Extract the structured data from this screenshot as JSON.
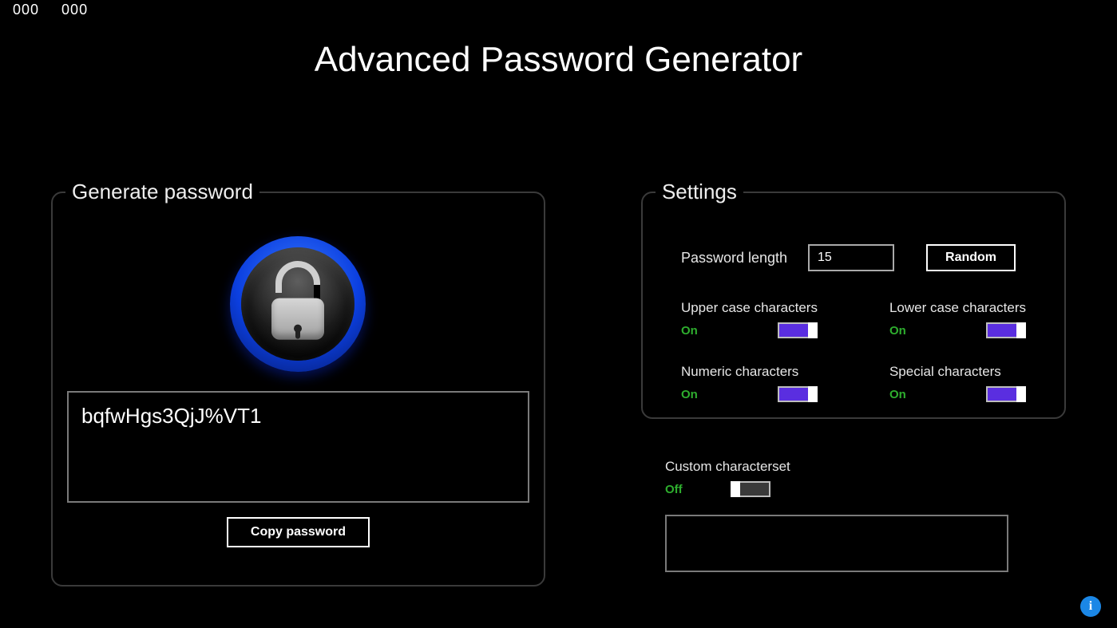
{
  "topnums": {
    "left": "000",
    "right": "000"
  },
  "title": "Advanced Password Generator",
  "left_panel": {
    "legend": "Generate password",
    "password": "bqfwHgs3QjJ%VT1",
    "copy_label": "Copy password"
  },
  "right_panel": {
    "legend": "Settings",
    "length_label": "Password length",
    "length_value": "15",
    "random_label": "Random",
    "toggles": {
      "upper": {
        "label": "Upper case characters",
        "state": "On",
        "on": true
      },
      "lower": {
        "label": "Lower case characters",
        "state": "On",
        "on": true
      },
      "numeric": {
        "label": "Numeric characters",
        "state": "On",
        "on": true
      },
      "special": {
        "label": "Special characters",
        "state": "On",
        "on": true
      }
    },
    "custom": {
      "label": "Custom characterset",
      "state": "Off",
      "on": false,
      "value": ""
    }
  },
  "info_glyph": "i"
}
